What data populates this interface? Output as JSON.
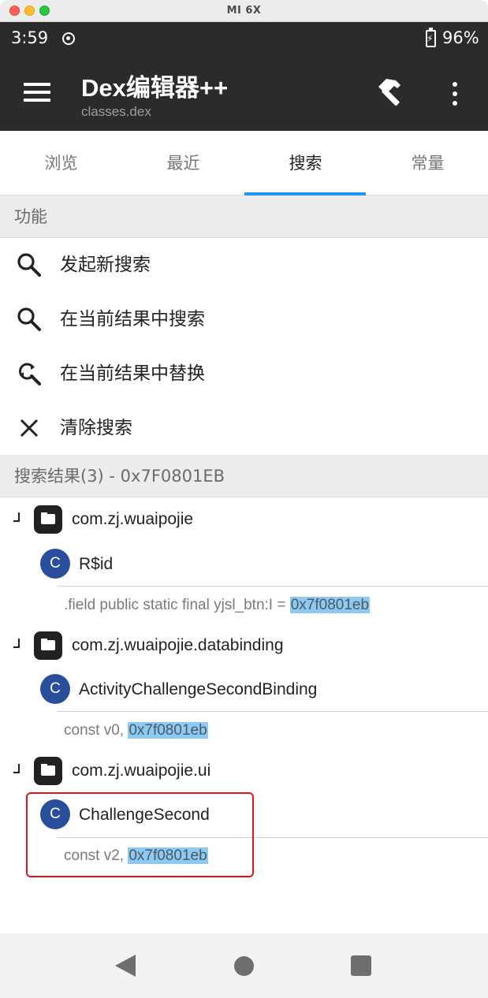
{
  "window": {
    "title": "MI 6X"
  },
  "status_bar": {
    "time": "3:59",
    "battery_percent": "96%"
  },
  "app_bar": {
    "title": "Dex编辑器++",
    "subtitle": "classes.dex"
  },
  "tabs": [
    {
      "label": "浏览",
      "active": false
    },
    {
      "label": "最近",
      "active": false
    },
    {
      "label": "搜索",
      "active": true
    },
    {
      "label": "常量",
      "active": false
    }
  ],
  "functions": {
    "header": "功能",
    "items": [
      {
        "label": "发起新搜索",
        "icon": "search-icon"
      },
      {
        "label": "在当前结果中搜索",
        "icon": "search-icon"
      },
      {
        "label": "在当前结果中替换",
        "icon": "find-replace-icon"
      },
      {
        "label": "清除搜索",
        "icon": "close-icon"
      }
    ]
  },
  "results": {
    "header": "搜索结果(3) - 0x7F0801EB",
    "groups": [
      {
        "package": "com.zj.wuaipojie",
        "class_badge": "C",
        "class_name": "R$id",
        "code_prefix": ".field public static final yjsl_btn:I = ",
        "code_match": "0x7f0801eb"
      },
      {
        "package": "com.zj.wuaipojie.databinding",
        "class_badge": "C",
        "class_name": "ActivityChallengeSecondBinding",
        "code_prefix": "const v0, ",
        "code_match": "0x7f0801eb"
      },
      {
        "package": "com.zj.wuaipojie.ui",
        "class_badge": "C",
        "class_name": "ChallengeSecond",
        "code_prefix": "const v2, ",
        "code_match": "0x7f0801eb"
      }
    ]
  },
  "colors": {
    "app_bar": "#2b2b2b",
    "tab_indicator": "#2196f3",
    "class_badge": "#2a4d9c",
    "highlight": "#8ec9f2",
    "annotation_box": "#e8101e"
  }
}
